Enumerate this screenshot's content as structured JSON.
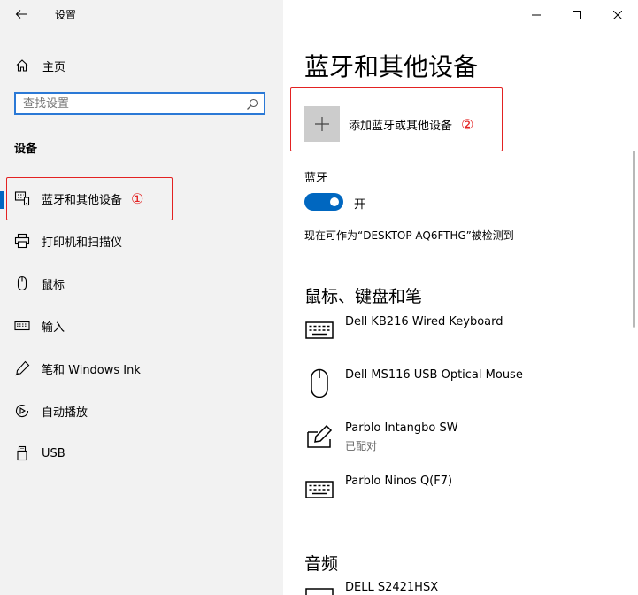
{
  "window": {
    "title": "设置",
    "controls": [
      "minimize-icon",
      "maximize-icon",
      "close-icon"
    ]
  },
  "sidebar": {
    "home_label": "主页",
    "search_placeholder": "查找设置",
    "section_label": "设备",
    "items": [
      {
        "label": "蓝牙和其他设备",
        "icon": "bluetooth-device-icon",
        "selected": true
      },
      {
        "label": "打印机和扫描仪",
        "icon": "printer-icon"
      },
      {
        "label": "鼠标",
        "icon": "mouse-icon"
      },
      {
        "label": "输入",
        "icon": "keyboard-icon"
      },
      {
        "label": "笔和 Windows Ink",
        "icon": "pen-icon"
      },
      {
        "label": "自动播放",
        "icon": "autoplay-icon"
      },
      {
        "label": "USB",
        "icon": "usb-icon"
      }
    ]
  },
  "main": {
    "title": "蓝牙和其他设备",
    "add_device_label": "添加蓝牙或其他设备",
    "bluetooth": {
      "label": "蓝牙",
      "state": "开",
      "on": true,
      "discoverable_text": "现在可作为“DESKTOP-AQ6FTHG”被检测到"
    },
    "sections": [
      {
        "title": "鼠标、键盘和笔",
        "devices": [
          {
            "name": "Dell KB216 Wired Keyboard",
            "status": "",
            "icon": "keyboard-icon"
          },
          {
            "name": "Dell MS116 USB Optical Mouse",
            "status": "",
            "icon": "mouse-icon"
          },
          {
            "name": "Parblo Intangbo SW",
            "status": "已配对",
            "icon": "pen-tablet-icon"
          },
          {
            "name": "Parblo Ninos Q(F7)",
            "status": "",
            "icon": "keyboard-icon"
          }
        ]
      },
      {
        "title": "音频",
        "devices": [
          {
            "name": "DELL S2421HSX",
            "status": "",
            "icon": "monitor-icon"
          }
        ]
      }
    ]
  },
  "annotations": {
    "marker_1": "①",
    "marker_2": "②",
    "color": "#e32222"
  },
  "colors": {
    "accent": "#0067c0",
    "sidebar_bg": "#f2f2f2",
    "search_border": "#2b79d6"
  }
}
